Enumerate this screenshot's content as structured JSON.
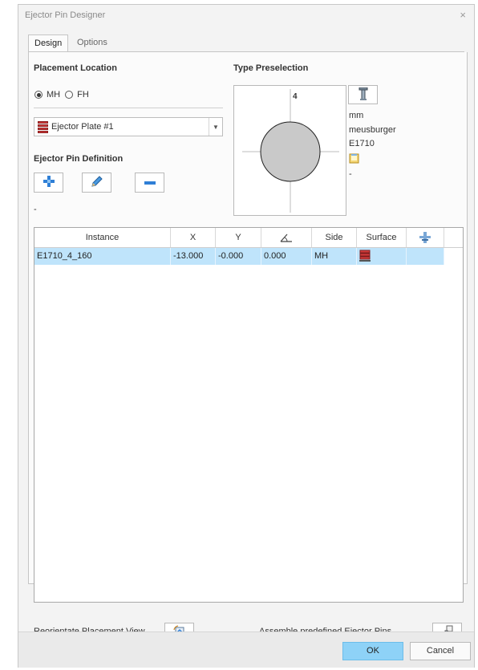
{
  "window": {
    "title": "Ejector Pin Designer",
    "close_glyph": "×"
  },
  "tabs": [
    {
      "label": "Design",
      "active": true
    },
    {
      "label": "Options",
      "active": false
    }
  ],
  "placement": {
    "heading": "Placement Location",
    "options": [
      {
        "label": "MH",
        "selected": true
      },
      {
        "label": "FH",
        "selected": false
      }
    ],
    "plate_select": {
      "value": "Ejector Plate #1",
      "icon": "ejector-plate-icon"
    }
  },
  "definition": {
    "heading": "Ejector Pin Definition",
    "buttons": [
      {
        "icon": "plus-icon"
      },
      {
        "icon": "pencil-icon"
      },
      {
        "icon": "minus-icon"
      }
    ],
    "status": "-"
  },
  "type_preselection": {
    "heading": "Type Preselection",
    "preview_label": "4",
    "unit": "mm",
    "manufacturer": "meusburger",
    "part": "E1710",
    "note_icon": "note-icon",
    "extra": "-"
  },
  "table": {
    "headers": [
      "Instance",
      "X",
      "Y",
      "",
      "Side",
      "Surface",
      ""
    ],
    "header_icons": {
      "angle": "angle-icon",
      "pin": "pin-icon"
    },
    "rows": [
      {
        "instance": "E1710_4_160",
        "x": "-13.000",
        "y": "-0.000",
        "angle": "0.000",
        "side": "MH",
        "surface_icon": "surface-icon"
      }
    ]
  },
  "bottom": {
    "reorientate_label": "Reorientate Placement View",
    "assemble_label": "Assemble predefined Ejector Pins"
  },
  "footer": {
    "ok": "OK",
    "cancel": "Cancel"
  },
  "colors": {
    "selection": "#bfe4fb",
    "ok_button": "#8ed2f7",
    "plate_red": "#d33b3b",
    "icon_blue": "#2f7fd6"
  }
}
